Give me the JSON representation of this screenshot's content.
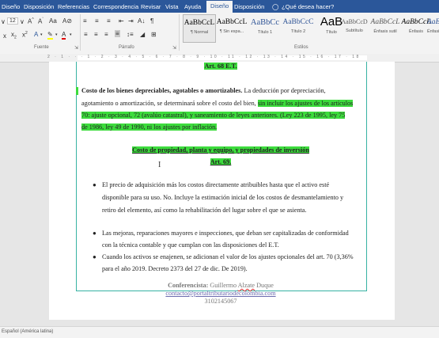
{
  "tabs": [
    "Diseño",
    "Disposición",
    "Referencias",
    "Correspondencia",
    "Revisar",
    "Vista",
    "Ayuda",
    "Diseño",
    "Disposición",
    "¿Qué desea hacer?"
  ],
  "ribbon": {
    "font_size": "12",
    "groups": {
      "font": "Fuente",
      "paragraph": "Párrafo",
      "styles": "Estilos"
    },
    "styles": [
      {
        "preview": "AaBbCcL",
        "name": "¶ Normal"
      },
      {
        "preview": "AaBbCcL",
        "name": "¶ Sin espa..."
      },
      {
        "preview": "AaBbCc",
        "name": "Título 1"
      },
      {
        "preview": "AaBbCcC",
        "name": "Título 2"
      },
      {
        "preview": "AaB",
        "name": "Título"
      },
      {
        "preview": "AaBbCcD",
        "name": "Subtítulo"
      },
      {
        "preview": "AaBbCcL",
        "name": "Énfasis sutil"
      },
      {
        "preview": "AaBbCcL",
        "name": "Énfasis"
      },
      {
        "preview": "AaBbCcL",
        "name": "Énfasi"
      }
    ]
  },
  "ruler": {
    "numbers": "2 · 1 · · · 1 · 2 · 3 · 4 · 5 · 6 · 7 · 8 · 9 · 10 · 11 · 12 · 13 · 14 · 15 · 16 · 17 · 18"
  },
  "document": {
    "art68": "Art. 68 E.T.",
    "p1_l1_bold": "Costo de los bienes depreciables, agotables o amortizables.",
    "p1_l1_rest": " La deducción por depreciación,",
    "p1_l2_a": "agotamiento o amortización, se determinará sobre el costo del bien,",
    "p1_l2_hl": "sin incluir los ajustes de los artículos",
    "p1_l3": "70: ajuste opcional, 72 (avalúo catastral), y saneamiento de leyes anteriores. (Ley 223 de 1995, ley 75",
    "p1_l4": "de 1986, ley 49 de 1990, ni los ajustes por inflación.",
    "heading2": "Costo de propiedad, planta y equipo, y propiedades de inversión",
    "art69": "Art. 69.",
    "b1_l1": "El precio de adquisición más los costos directamente atribuibles hasta que el activo esté",
    "b1_l2": "disponible para su uso. No. Incluye la estimación inicial de los costos de desmantelamiento y",
    "b1_l3": "retiro del elemento, así como la rehabilitación del lugar sobre el que se asienta.",
    "b2_l1": "Las mejoras, reparaciones mayores e inspecciones, que deban ser capitalizadas de conformidad",
    "b2_l2": "con la técnica contable y que cumplan con las disposiciones del E.T.",
    "b3_l1": "Cuando los activos se enajenen, se adicionan el valor de los ajustes opcionales del art. 70 (3,36%",
    "b3_l2": "para el año 2019. Decreto 2373 del 27 de dic. De 2019).",
    "footer_label": "Conferencista:",
    "footer_name_a": " Guillermo ",
    "footer_name_b": "Alzate",
    "footer_name_c": " Duque",
    "footer_email": "contacto@portaltributariodecolombia.com",
    "footer_phone": "3102145067"
  },
  "status": {
    "language": "Español (América latina)"
  },
  "colors": {
    "ribbon_blue": "#2b579a",
    "highlight": "#3ddc3d",
    "frame": "#37b2a2"
  }
}
